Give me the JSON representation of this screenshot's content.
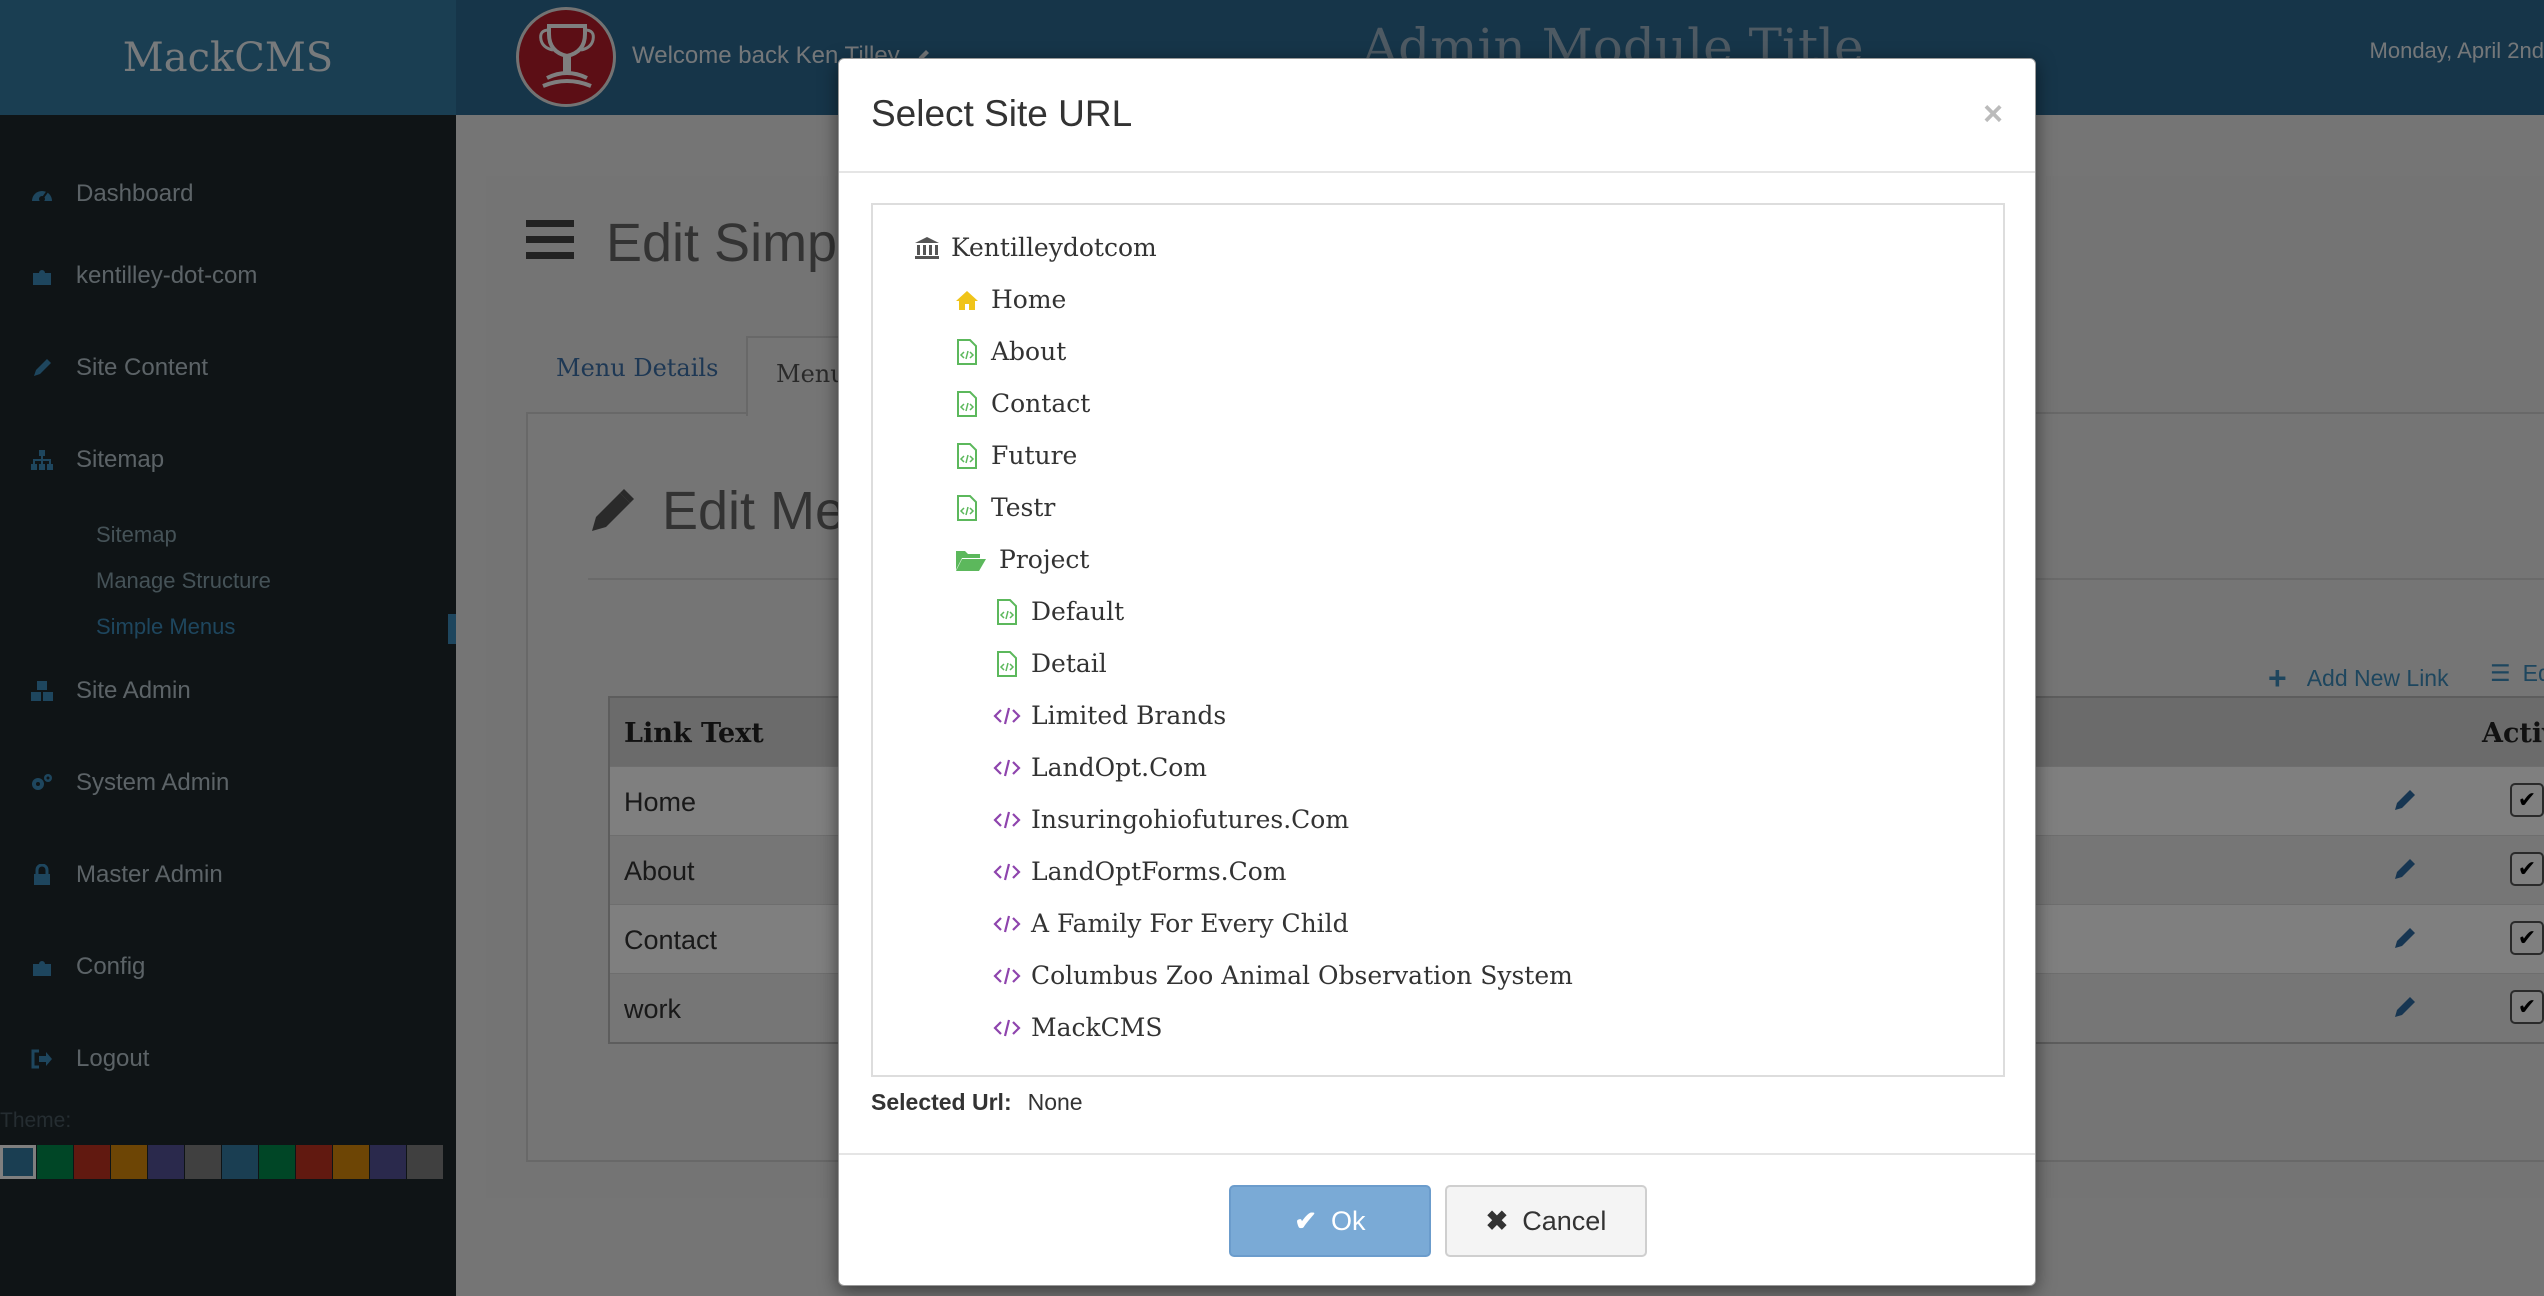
{
  "app": {
    "brand": "MackCMS",
    "welcome": "Welcome back Ken Tilley",
    "page_title": "Admin Module Title",
    "date": "Monday, April 2nd"
  },
  "sidebar": {
    "items": [
      {
        "label": "Dashboard",
        "icon": "dashboard-icon"
      },
      {
        "label": "kentilley-dot-com",
        "icon": "puzzle-icon"
      },
      {
        "label": "Site Content",
        "icon": "pencil-icon"
      },
      {
        "label": "Sitemap",
        "icon": "sitemap-icon"
      },
      {
        "label": "Site Admin",
        "icon": "cubes-icon"
      },
      {
        "label": "System Admin",
        "icon": "gears-icon"
      },
      {
        "label": "Master Admin",
        "icon": "lock-icon"
      },
      {
        "label": "Config",
        "icon": "puzzle-icon"
      },
      {
        "label": "Logout",
        "icon": "sign-out-icon"
      }
    ],
    "sitemap_sub": [
      "Sitemap",
      "Manage Structure",
      "Simple Menus"
    ],
    "theme_label": "Theme:",
    "theme_colors": [
      "#357ca5",
      "#008d4c",
      "#c23321",
      "#db8b0b",
      "#555299",
      "#808080",
      "#357ca5",
      "#008d4c",
      "#c23321",
      "#db8b0b",
      "#555299",
      "#808080"
    ]
  },
  "background": {
    "edit_title": "Edit Simpl",
    "tabs": [
      "Menu Details",
      "Menu"
    ],
    "edit_menu_title": "Edit Me",
    "add_link": "Add New Link",
    "edit_link": "Ed",
    "table": {
      "headers": [
        "Link Text",
        "Activ"
      ],
      "rows": [
        "Home",
        "About",
        "Contact",
        "work"
      ]
    }
  },
  "modal": {
    "title": "Select Site URL",
    "close": "×",
    "tree": [
      {
        "label": "Kentilleydotcom",
        "icon": "bank-icon"
      },
      {
        "label": "Home",
        "icon": "home-icon"
      },
      {
        "label": "About",
        "icon": "page-code-icon"
      },
      {
        "label": "Contact",
        "icon": "page-code-icon"
      },
      {
        "label": "Future",
        "icon": "page-code-icon"
      },
      {
        "label": "Testr",
        "icon": "page-code-icon"
      },
      {
        "label": "Project",
        "icon": "folder-open-icon"
      },
      {
        "label": "Default",
        "icon": "page-code-icon"
      },
      {
        "label": "Detail",
        "icon": "page-code-icon"
      },
      {
        "label": "Limited Brands",
        "icon": "code-icon"
      },
      {
        "label": "LandOpt.Com",
        "icon": "code-icon"
      },
      {
        "label": "Insuringohiofutures.Com",
        "icon": "code-icon"
      },
      {
        "label": "LandOptForms.Com",
        "icon": "code-icon"
      },
      {
        "label": "A Family For Every Child",
        "icon": "code-icon"
      },
      {
        "label": "Columbus Zoo Animal Observation System",
        "icon": "code-icon"
      },
      {
        "label": "MackCMS",
        "icon": "code-icon"
      }
    ],
    "selected_url_label": "Selected Url:",
    "selected_url_value": "None",
    "ok_label": "Ok",
    "cancel_label": "Cancel"
  },
  "colors": {
    "brand": "#357ca5",
    "topbar": "#2d6a93",
    "sidebar": "#1e282c",
    "accent": "#3c8dbc",
    "page_icon": "#5cb85c",
    "code_icon": "#8e44ad",
    "home_icon": "#f0c419"
  }
}
